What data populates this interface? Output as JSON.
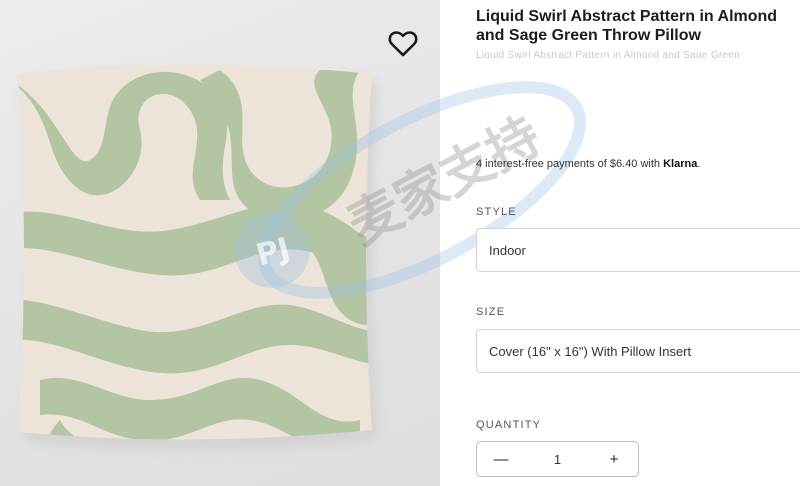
{
  "product": {
    "title_line1": "Liquid Swirl Abstract Pattern in Almond",
    "title_line2": "and Sage Green Throw Pillow",
    "subtitle": "Liquid Swirl Abstract Pattern in Almond and Sage Green",
    "installments_prefix": "4 interest-free payments of $6.40 with ",
    "installments_brand": "Klarna",
    "installments_suffix": "."
  },
  "options": {
    "style_label": "STYLE",
    "style_value": "Indoor",
    "size_label": "SIZE",
    "size_value": "Cover (16\" x 16\") With Pillow Insert",
    "quantity_label": "QUANTITY",
    "quantity_value": "1",
    "decrement_symbol": "—",
    "increment_symbol": "+"
  },
  "watermark": {
    "text": "麦家支持",
    "logo_text": "PJ"
  },
  "colors": {
    "sage": "#b4c5a4",
    "almond": "#ece4d8",
    "watermark": "#9fc0e6"
  },
  "icons": {
    "favorite": "heart-outline-icon"
  }
}
